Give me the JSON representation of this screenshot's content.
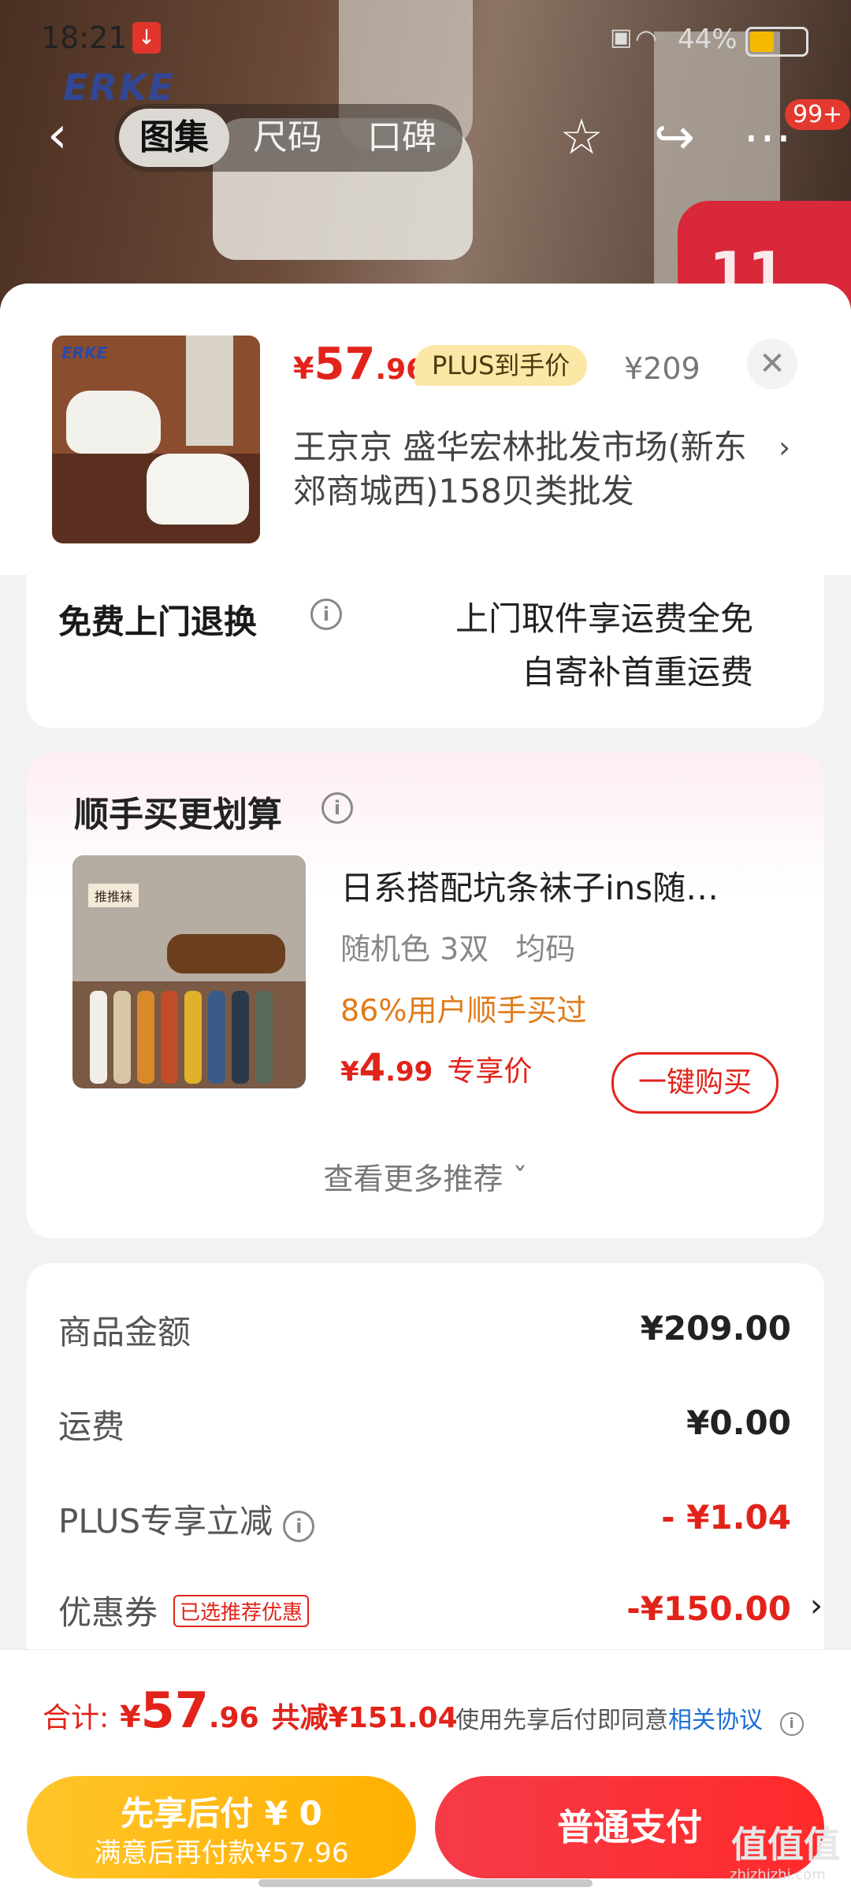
{
  "status_bar": {
    "time": "18:21",
    "battery_pct": "44%",
    "battery_level": 0.44
  },
  "nav": {
    "tabs": [
      {
        "label": "图集",
        "active": true
      },
      {
        "label": "尺码"
      },
      {
        "label": "口碑"
      }
    ],
    "badge": "99+"
  },
  "product": {
    "price": {
      "yen": "¥",
      "int": "57",
      "dec": ".96"
    },
    "plus_tag": "PLUS到手价",
    "original_price": "¥209",
    "seller": "王京京  盛华宏林批发市场(新东郊商城西)158贝类批发"
  },
  "return_policy": {
    "label": "免费上门退换",
    "line1": "上门取件享运费全免",
    "line2": "自寄补首重运费"
  },
  "recommend": {
    "title": "顺手买更划算",
    "item": {
      "name": "日系搭配坑条袜子ins随…",
      "spec_color": "随机色 3双",
      "spec_size": "均码",
      "buyers": "86%用户顺手买过",
      "price": {
        "yen": "¥",
        "int": "4",
        "dec": ".99"
      },
      "price_note": "专享价",
      "buy_label": "一键购买"
    },
    "more_label": "查看更多推荐 ˇ"
  },
  "summary": {
    "rows": [
      {
        "label": "商品金额",
        "value": "¥209.00"
      },
      {
        "label": "运费",
        "value": "¥0.00"
      },
      {
        "label": "PLUS专享立减",
        "value": "- ¥1.04"
      },
      {
        "label": "优惠券",
        "tag": "已选推荐优惠",
        "value": "-¥150.00"
      }
    ]
  },
  "bottom": {
    "total_label": "合计:",
    "total": {
      "yen": "¥",
      "int": "57",
      "dec": ".96"
    },
    "saved": "共减¥151.04",
    "agree_prefix": "使用先享后付即同意",
    "agree_link": "相关协议",
    "later_btn_line1": "先享后付 ¥ 0",
    "later_btn_line2": "满意后再付款¥57.96",
    "pay_btn": "普通支付"
  },
  "watermark": {
    "main": "值值值",
    "sub": "zhizhizhi.com"
  },
  "colors": {
    "accent_red": "#e2231a",
    "plus_gold": "#fbe7a6",
    "later_btn": "#ffb000",
    "link_blue": "#1c6fd6"
  }
}
